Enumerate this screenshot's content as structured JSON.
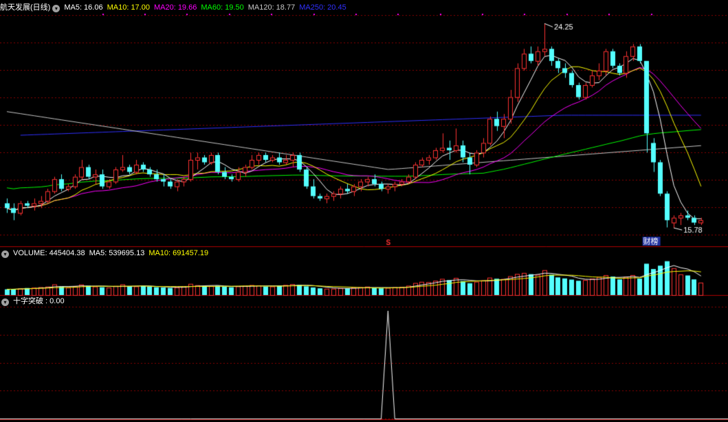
{
  "colors": {
    "up": "#ff3232",
    "down": "#54ffff",
    "grid": "#8b0000",
    "ma5": "#ffffff",
    "ma10": "#ffff00",
    "ma20": "#ff00ff",
    "ma60": "#00ff00",
    "ma120": "#c8c8c8",
    "ma250": "#3030ff"
  },
  "price_panel": {
    "title": "航天发展(日线)",
    "ma_labels": [
      {
        "key": "ma5",
        "text": "MA5: 16.06",
        "color": "#ffffff"
      },
      {
        "key": "ma10",
        "text": "MA10: 17.00",
        "color": "#ffff00"
      },
      {
        "key": "ma20",
        "text": "MA20: 19.66",
        "color": "#ff00ff"
      },
      {
        "key": "ma60",
        "text": "MA60: 19.50",
        "color": "#00ff00"
      },
      {
        "key": "ma120",
        "text": "MA120: 18.77",
        "color": "#c8c8c8"
      },
      {
        "key": "ma250",
        "text": "MA250: 20.45",
        "color": "#3030ff"
      }
    ],
    "high_label": "24.25",
    "low_label": "15.78",
    "marker_s": "S",
    "marker_cai": "财榜"
  },
  "volume_panel": {
    "labels": [
      {
        "text": "VOLUME: 445404.38",
        "color": "#ffffff"
      },
      {
        "text": "MA5: 539695.13",
        "color": "#ffffff"
      },
      {
        "text": "MA10: 691457.19",
        "color": "#ffff00"
      }
    ]
  },
  "indicator_panel": {
    "label": "十字突破 : 0.00",
    "color": "#ffffff"
  },
  "chart_data": {
    "type": "candlestick",
    "y_range": [
      15.5,
      24.6
    ],
    "candles": [
      [
        16.8,
        17.0,
        16.4,
        16.6
      ],
      [
        16.6,
        16.8,
        16.1,
        16.4
      ],
      [
        16.4,
        16.9,
        16.3,
        16.8
      ],
      [
        16.8,
        16.9,
        16.6,
        16.7
      ],
      [
        16.7,
        17.0,
        16.5,
        16.8
      ],
      [
        16.8,
        17.1,
        16.6,
        16.9
      ],
      [
        16.9,
        17.4,
        16.8,
        17.3
      ],
      [
        17.3,
        17.9,
        17.2,
        17.8
      ],
      [
        17.8,
        18.0,
        17.3,
        17.4
      ],
      [
        17.4,
        17.6,
        17.3,
        17.5
      ],
      [
        17.5,
        18.0,
        17.4,
        17.9
      ],
      [
        17.9,
        18.6,
        17.8,
        18.3
      ],
      [
        18.3,
        18.4,
        17.8,
        17.9
      ],
      [
        17.9,
        18.2,
        17.6,
        18.0
      ],
      [
        18.0,
        18.2,
        17.4,
        17.5
      ],
      [
        17.5,
        17.8,
        17.4,
        17.7
      ],
      [
        17.7,
        18.3,
        17.6,
        18.2
      ],
      [
        18.2,
        18.8,
        18.1,
        18.3
      ],
      [
        18.3,
        18.4,
        18.0,
        18.1
      ],
      [
        18.1,
        18.6,
        18.0,
        18.4
      ],
      [
        18.4,
        18.5,
        18.1,
        18.2
      ],
      [
        18.2,
        18.3,
        17.9,
        18.0
      ],
      [
        18.0,
        18.2,
        17.7,
        17.8
      ],
      [
        17.8,
        18.0,
        17.5,
        17.7
      ],
      [
        17.7,
        17.8,
        17.4,
        17.5
      ],
      [
        17.5,
        17.8,
        17.3,
        17.7
      ],
      [
        17.7,
        17.9,
        17.5,
        17.8
      ],
      [
        17.8,
        18.9,
        17.7,
        18.6
      ],
      [
        18.6,
        18.9,
        18.2,
        18.7
      ],
      [
        18.7,
        18.8,
        18.4,
        18.5
      ],
      [
        18.5,
        18.9,
        18.4,
        18.8
      ],
      [
        18.8,
        18.9,
        18.0,
        18.1
      ],
      [
        18.1,
        18.3,
        17.8,
        17.9
      ],
      [
        17.9,
        18.0,
        17.7,
        17.8
      ],
      [
        17.8,
        18.3,
        17.7,
        18.1
      ],
      [
        18.1,
        18.4,
        17.9,
        18.3
      ],
      [
        18.3,
        18.8,
        18.2,
        18.6
      ],
      [
        18.6,
        18.9,
        18.4,
        18.8
      ],
      [
        18.8,
        18.9,
        18.5,
        18.6
      ],
      [
        18.6,
        18.8,
        18.5,
        18.7
      ],
      [
        18.7,
        18.9,
        18.4,
        18.5
      ],
      [
        18.5,
        18.8,
        18.4,
        18.6
      ],
      [
        18.6,
        18.9,
        18.3,
        18.8
      ],
      [
        18.8,
        18.9,
        18.1,
        18.2
      ],
      [
        18.2,
        18.3,
        17.4,
        17.5
      ],
      [
        17.5,
        17.8,
        17.0,
        17.1
      ],
      [
        17.1,
        17.2,
        16.9,
        17.0
      ],
      [
        17.0,
        17.2,
        16.8,
        17.1
      ],
      [
        17.1,
        17.3,
        16.9,
        17.2
      ],
      [
        17.2,
        17.5,
        17.0,
        17.4
      ],
      [
        17.4,
        17.6,
        17.2,
        17.3
      ],
      [
        17.3,
        17.6,
        17.1,
        17.5
      ],
      [
        17.5,
        17.8,
        17.3,
        17.7
      ],
      [
        17.7,
        17.9,
        17.5,
        17.8
      ],
      [
        17.8,
        18.0,
        17.5,
        17.6
      ],
      [
        17.6,
        17.7,
        17.3,
        17.4
      ],
      [
        17.4,
        17.6,
        17.2,
        17.5
      ],
      [
        17.5,
        17.7,
        17.3,
        17.6
      ],
      [
        17.6,
        17.8,
        17.5,
        17.7
      ],
      [
        17.7,
        18.0,
        17.6,
        17.9
      ],
      [
        17.9,
        18.5,
        17.8,
        18.4
      ],
      [
        18.4,
        18.7,
        18.3,
        18.6
      ],
      [
        18.6,
        18.8,
        18.4,
        18.7
      ],
      [
        18.7,
        19.1,
        18.6,
        19.0
      ],
      [
        19.0,
        19.7,
        18.9,
        19.1
      ],
      [
        19.1,
        19.4,
        18.6,
        19.0
      ],
      [
        19.0,
        19.9,
        18.9,
        19.2
      ],
      [
        19.2,
        19.4,
        18.5,
        18.7
      ],
      [
        18.7,
        18.9,
        18.0,
        18.4
      ],
      [
        18.4,
        19.0,
        18.3,
        18.9
      ],
      [
        18.9,
        19.5,
        18.7,
        19.3
      ],
      [
        19.3,
        20.4,
        19.2,
        20.3
      ],
      [
        20.3,
        20.6,
        19.8,
        20.0
      ],
      [
        20.0,
        20.5,
        19.5,
        20.3
      ],
      [
        20.3,
        21.5,
        20.1,
        21.2
      ],
      [
        21.2,
        22.6,
        21.0,
        22.4
      ],
      [
        22.4,
        23.2,
        22.3,
        23.0
      ],
      [
        23.0,
        23.3,
        22.6,
        22.7
      ],
      [
        22.7,
        23.3,
        22.5,
        23.1
      ],
      [
        23.1,
        24.25,
        22.9,
        23.2
      ],
      [
        23.2,
        23.3,
        22.5,
        22.7
      ],
      [
        22.7,
        22.8,
        22.2,
        22.4
      ],
      [
        22.4,
        22.6,
        22.0,
        22.2
      ],
      [
        22.2,
        22.3,
        21.6,
        21.7
      ],
      [
        21.7,
        21.8,
        21.1,
        21.2
      ],
      [
        21.2,
        21.8,
        21.1,
        21.7
      ],
      [
        21.7,
        22.3,
        21.6,
        22.1
      ],
      [
        22.1,
        22.6,
        21.9,
        22.3
      ],
      [
        22.3,
        23.2,
        22.1,
        23.1
      ],
      [
        23.1,
        23.2,
        22.4,
        22.5
      ],
      [
        22.5,
        22.6,
        22.1,
        22.2
      ],
      [
        22.2,
        23.1,
        22.0,
        22.9
      ],
      [
        22.9,
        23.4,
        22.7,
        23.3
      ],
      [
        23.3,
        23.4,
        22.6,
        22.7
      ],
      [
        22.7,
        19.9,
        18.9,
        19.7
      ],
      [
        19.3,
        19.5,
        18.1,
        18.5
      ],
      [
        18.5,
        18.6,
        17.1,
        17.2
      ],
      [
        17.2,
        17.3,
        15.8,
        16.1
      ],
      [
        16.0,
        16.3,
        15.78,
        16.2
      ],
      [
        16.2,
        16.4,
        15.9,
        16.3
      ],
      [
        16.3,
        16.5,
        16.1,
        16.2
      ],
      [
        16.2,
        16.3,
        15.9,
        16.0
      ],
      [
        16.0,
        16.2,
        15.9,
        16.1
      ]
    ],
    "volume": [
      205000,
      214000,
      235000,
      251000,
      265000,
      282000,
      300000,
      381000,
      297000,
      269000,
      318000,
      378000,
      335000,
      305000,
      279000,
      267000,
      323000,
      382000,
      310000,
      311000,
      320000,
      303000,
      280000,
      270000,
      254000,
      278000,
      312000,
      400000,
      351000,
      310000,
      326000,
      332000,
      299000,
      278000,
      310000,
      328000,
      356000,
      345000,
      303000,
      307000,
      330000,
      360000,
      389000,
      363000,
      310000,
      272000,
      241000,
      228000,
      226000,
      248000,
      244000,
      263000,
      282000,
      302000,
      251000,
      241000,
      258000,
      280000,
      293000,
      335000,
      430000,
      472000,
      461000,
      511000,
      578000,
      534000,
      612000,
      498000,
      422000,
      475000,
      525000,
      623000,
      584000,
      574000,
      674000,
      755000,
      790000,
      746000,
      722000,
      889000,
      727000,
      631000,
      594000,
      553000,
      510000,
      537000,
      589000,
      645000,
      711000,
      660000,
      560000,
      650000,
      713000,
      587000,
      1120000,
      930000,
      1050000,
      1210000,
      960000,
      740000,
      700000,
      560000,
      445404
    ],
    "volume_y_range": [
      0,
      1300000
    ],
    "indicator": {
      "spike_index": 56,
      "spike_value": 1,
      "current_value": 0
    }
  }
}
